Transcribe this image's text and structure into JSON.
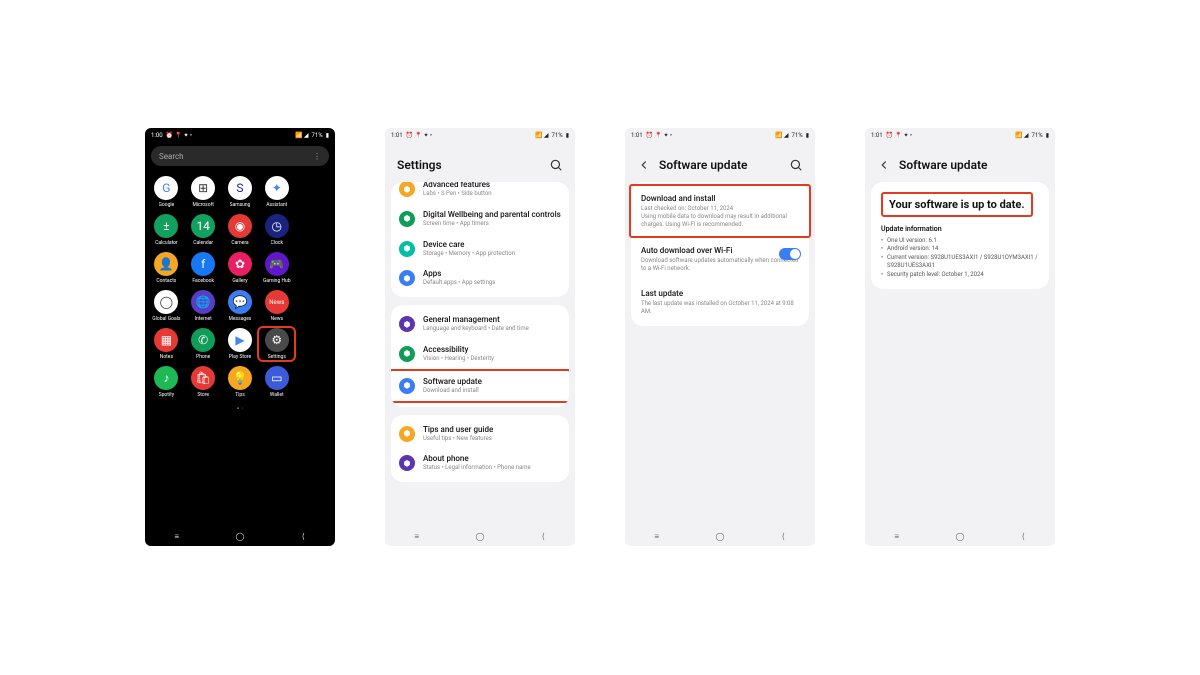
{
  "status": {
    "time_s1": "1:00",
    "time_s2": "1:01",
    "time_s3": "1:01",
    "time_s4": "1:01",
    "status_icons": "⏰ 📍 ✦ •",
    "battery": "71%",
    "signal_icons": "📶 ◢"
  },
  "screen1": {
    "search_placeholder": "Search",
    "more_icon": "⋮",
    "apps": [
      {
        "label": "Google",
        "bg": "#ffffff",
        "fg": "#4285f4",
        "glyph": "G"
      },
      {
        "label": "Microsoft",
        "bg": "#ffffff",
        "fg": "#333",
        "glyph": "⊞"
      },
      {
        "label": "Samsung",
        "bg": "#ffffff",
        "fg": "#1428a0",
        "glyph": "S"
      },
      {
        "label": "Assistant",
        "bg": "#ffffff",
        "fg": "#4285f4",
        "glyph": "✦"
      },
      {
        "label": "",
        "bg": "transparent",
        "fg": "#fff",
        "glyph": ""
      },
      {
        "label": "Calculator",
        "bg": "#13a05f",
        "fg": "#fff",
        "glyph": "±"
      },
      {
        "label": "Calendar",
        "bg": "#13a05f",
        "fg": "#fff",
        "glyph": "14"
      },
      {
        "label": "Camera",
        "bg": "#e53935",
        "fg": "#fff",
        "glyph": "◉"
      },
      {
        "label": "Clock",
        "bg": "#1a237e",
        "fg": "#fff",
        "glyph": "◷"
      },
      {
        "label": "",
        "bg": "transparent",
        "fg": "#fff",
        "glyph": ""
      },
      {
        "label": "Contacts",
        "bg": "#f5a623",
        "fg": "#fff",
        "glyph": "👤"
      },
      {
        "label": "Facebook",
        "bg": "#1877f2",
        "fg": "#fff",
        "glyph": "f"
      },
      {
        "label": "Gallery",
        "bg": "#e91e63",
        "fg": "#fff",
        "glyph": "✿"
      },
      {
        "label": "Gaming Hub",
        "bg": "#5e17c9",
        "fg": "#fff",
        "glyph": "🎮"
      },
      {
        "label": "",
        "bg": "transparent",
        "fg": "#fff",
        "glyph": ""
      },
      {
        "label": "Global Goals",
        "bg": "#ffffff",
        "fg": "#333",
        "glyph": "◯"
      },
      {
        "label": "Internet",
        "bg": "#5b3cc4",
        "fg": "#fff",
        "glyph": "🌐"
      },
      {
        "label": "Messages",
        "bg": "#3b7ef3",
        "fg": "#fff",
        "glyph": "💬"
      },
      {
        "label": "News",
        "bg": "#e53935",
        "fg": "#fff",
        "glyph": "News"
      },
      {
        "label": "",
        "bg": "transparent",
        "fg": "#fff",
        "glyph": ""
      },
      {
        "label": "Notes",
        "bg": "#e53935",
        "fg": "#fff",
        "glyph": "▦"
      },
      {
        "label": "Phone",
        "bg": "#0f9d58",
        "fg": "#fff",
        "glyph": "✆"
      },
      {
        "label": "Play Store",
        "bg": "#ffffff",
        "fg": "#4285f4",
        "glyph": "▶"
      },
      {
        "label": "Settings",
        "bg": "#4a4a4a",
        "fg": "#fff",
        "glyph": "⚙",
        "highlight": true
      },
      {
        "label": "",
        "bg": "transparent",
        "fg": "#fff",
        "glyph": ""
      },
      {
        "label": "Spotify",
        "bg": "#1db954",
        "fg": "#fff",
        "glyph": "♪"
      },
      {
        "label": "Store",
        "bg": "#e53935",
        "fg": "#fff",
        "glyph": "🛍"
      },
      {
        "label": "Tips",
        "bg": "#f5a623",
        "fg": "#fff",
        "glyph": "💡"
      },
      {
        "label": "Wallet",
        "bg": "#3b5bdb",
        "fg": "#fff",
        "glyph": "▭"
      },
      {
        "label": "",
        "bg": "transparent",
        "fg": "#fff",
        "glyph": ""
      }
    ]
  },
  "screen2": {
    "title": "Settings",
    "items": [
      {
        "icon_bg": "#f5a623",
        "title": "Advanced features",
        "sub": "Labs • S Pen • Side button",
        "cut": true
      },
      {
        "icon_bg": "#0f9d58",
        "title": "Digital Wellbeing and parental controls",
        "sub": "Screen time • App timers"
      },
      {
        "icon_bg": "#00bfa5",
        "title": "Device care",
        "sub": "Storage • Memory • App protection"
      },
      {
        "icon_bg": "#3b7ef3",
        "title": "Apps",
        "sub": "Default apps • App settings"
      },
      {
        "icon_bg": "#5e35b1",
        "title": "General management",
        "sub": "Language and keyboard • Date and time",
        "gap": true
      },
      {
        "icon_bg": "#0f9d58",
        "title": "Accessibility",
        "sub": "Vision • Hearing • Dexterity"
      },
      {
        "icon_bg": "#3b7ef3",
        "title": "Software update",
        "sub": "Download and install",
        "highlight": true
      },
      {
        "icon_bg": "#f5a623",
        "title": "Tips and user guide",
        "sub": "Useful tips • New features",
        "gap": true
      },
      {
        "icon_bg": "#5e35b1",
        "title": "About phone",
        "sub": "Status • Legal information • Phone name"
      }
    ]
  },
  "screen3": {
    "title": "Software update",
    "items": [
      {
        "title": "Download and install",
        "sub": "Last checked on: October 11, 2024\nUsing mobile data to download may result in additional charges. Using Wi-Fi is recommended.",
        "highlight": true
      },
      {
        "title": "Auto download over Wi-Fi",
        "sub": "Download software updates automatically when connected to a Wi-Fi network.",
        "toggle": true
      },
      {
        "title": "Last update",
        "sub": "The last update was installed on October 11, 2024 at 9:08 AM."
      }
    ]
  },
  "screen4": {
    "title": "Software update",
    "headline": "Your software is up to date.",
    "info_label": "Update information",
    "bullets": [
      "One UI version: 6.1",
      "Android version: 14",
      "Current version: S928U1UES3AXI1 / S928U1OYM3AXI1 / S928U1UES3AXI1",
      "Security patch level: October 1, 2024"
    ]
  },
  "nav_icons": {
    "recent": "≡",
    "home": "◯",
    "back": "⟨"
  }
}
